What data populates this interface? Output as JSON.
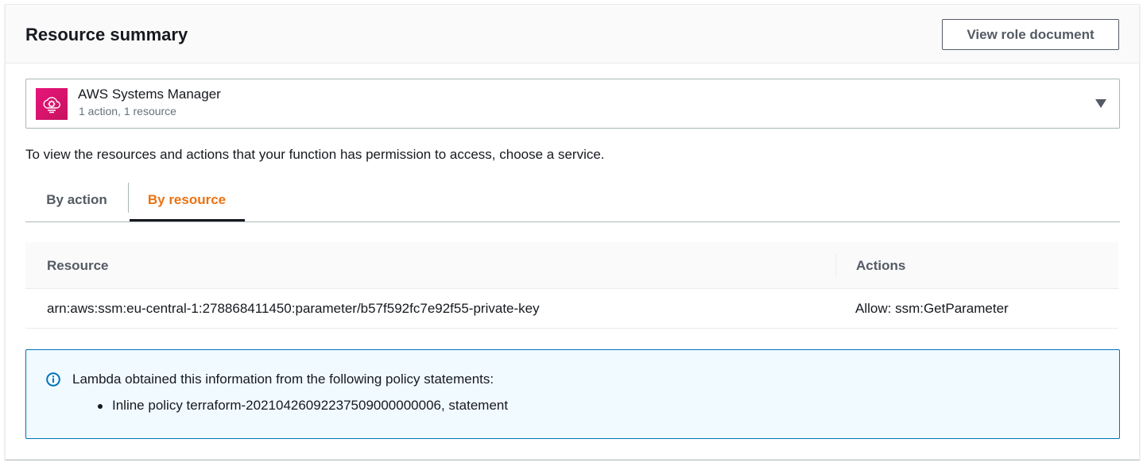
{
  "panel": {
    "title": "Resource summary",
    "view_role_button": "View role document"
  },
  "service_select": {
    "icon": "systems-manager-icon",
    "name": "AWS Systems Manager",
    "description": "1 action, 1 resource"
  },
  "help_text": "To view the resources and actions that your function has permission to access, choose a service.",
  "tabs": [
    {
      "label": "By action",
      "selected": false
    },
    {
      "label": "By resource",
      "selected": true
    }
  ],
  "table": {
    "columns": [
      "Resource",
      "Actions"
    ],
    "rows": [
      {
        "resource": "arn:aws:ssm:eu-central-1:278868411450:parameter/b57f592fc7e92f55-private-key",
        "actions": "Allow: ssm:GetParameter"
      }
    ]
  },
  "info": {
    "icon": "info-icon",
    "title": "Lambda obtained this information from the following policy statements:",
    "statements": [
      "Inline policy terraform-20210426092237509000000006, statement"
    ]
  },
  "colors": {
    "accent": "#ec7211",
    "info_border": "#0073bb",
    "info_bg": "#f1faff",
    "service_icon": "#e7157b"
  }
}
